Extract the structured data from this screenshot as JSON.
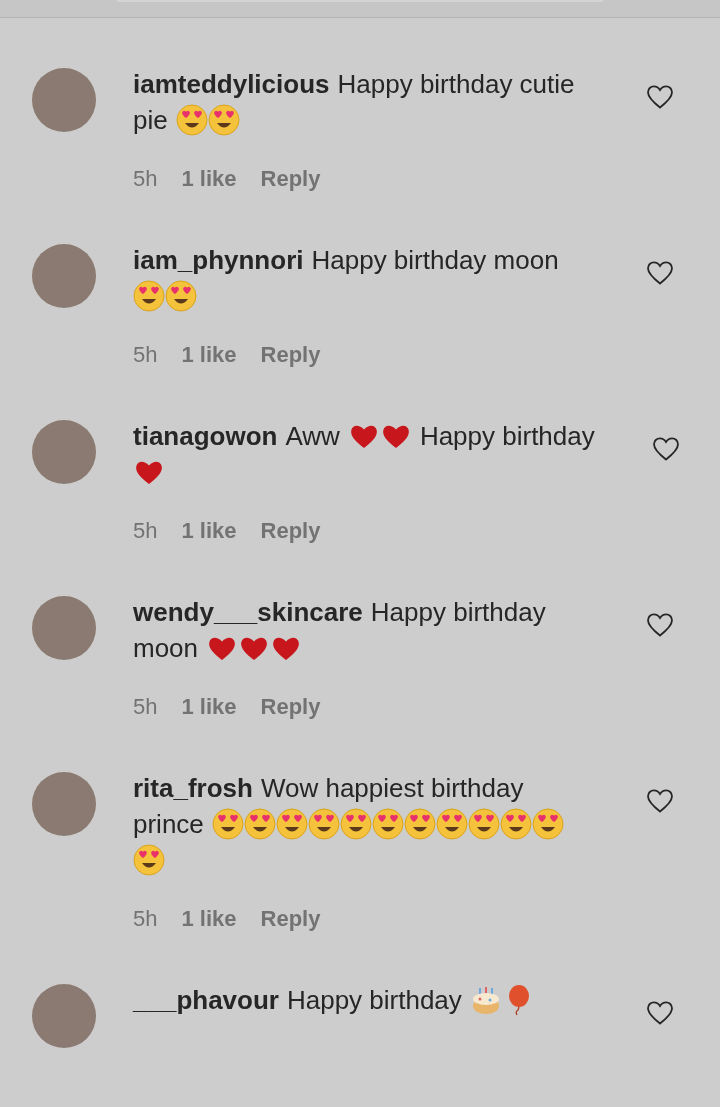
{
  "comments": [
    {
      "username": "iamteddylicious",
      "lines": [
        [
          {
            "kind": "text",
            "text": "Happy birthday cutie"
          }
        ],
        [
          {
            "kind": "text",
            "text": "pie"
          },
          {
            "kind": "heart_eyes"
          },
          {
            "kind": "heart_eyes"
          }
        ]
      ],
      "time": "5h",
      "likes": "1 like",
      "reply": "Reply"
    },
    {
      "username": "iam_phynnori",
      "lines": [
        [
          {
            "kind": "text",
            "text": "Happy birthday moon"
          }
        ],
        [
          {
            "kind": "heart_eyes"
          },
          {
            "kind": "heart_eyes"
          }
        ]
      ],
      "time": "5h",
      "likes": "1 like",
      "reply": "Reply"
    },
    {
      "username": "tianagowon",
      "lines": [
        [
          {
            "kind": "text",
            "text": "Aww"
          },
          {
            "kind": "red_heart"
          },
          {
            "kind": "red_heart"
          },
          {
            "kind": "text",
            "text": "Happy birthday"
          }
        ],
        [
          {
            "kind": "red_heart"
          }
        ]
      ],
      "time": "5h",
      "likes": "1 like",
      "reply": "Reply"
    },
    {
      "username": "wendy___skincare",
      "lines": [
        [
          {
            "kind": "text",
            "text": "Happy birthday"
          }
        ],
        [
          {
            "kind": "text",
            "text": "moon"
          },
          {
            "kind": "red_heart"
          },
          {
            "kind": "red_heart"
          },
          {
            "kind": "red_heart"
          }
        ]
      ],
      "time": "5h",
      "likes": "1 like",
      "reply": "Reply"
    },
    {
      "username": "rita_frosh",
      "lines": [
        [
          {
            "kind": "text",
            "text": "Wow happiest birthday"
          }
        ],
        [
          {
            "kind": "text",
            "text": "prince"
          },
          {
            "kind": "heart_eyes"
          },
          {
            "kind": "heart_eyes"
          },
          {
            "kind": "heart_eyes"
          },
          {
            "kind": "heart_eyes"
          },
          {
            "kind": "heart_eyes"
          },
          {
            "kind": "heart_eyes"
          },
          {
            "kind": "heart_eyes"
          },
          {
            "kind": "heart_eyes"
          },
          {
            "kind": "heart_eyes"
          },
          {
            "kind": "heart_eyes"
          },
          {
            "kind": "heart_eyes"
          }
        ],
        [
          {
            "kind": "heart_eyes"
          }
        ]
      ],
      "time": "5h",
      "likes": "1 like",
      "reply": "Reply"
    },
    {
      "username": "___phavour",
      "lines": [
        [
          {
            "kind": "text",
            "text": "Happy birthday"
          },
          {
            "kind": "cake"
          },
          {
            "kind": "balloon"
          }
        ]
      ]
    }
  ]
}
